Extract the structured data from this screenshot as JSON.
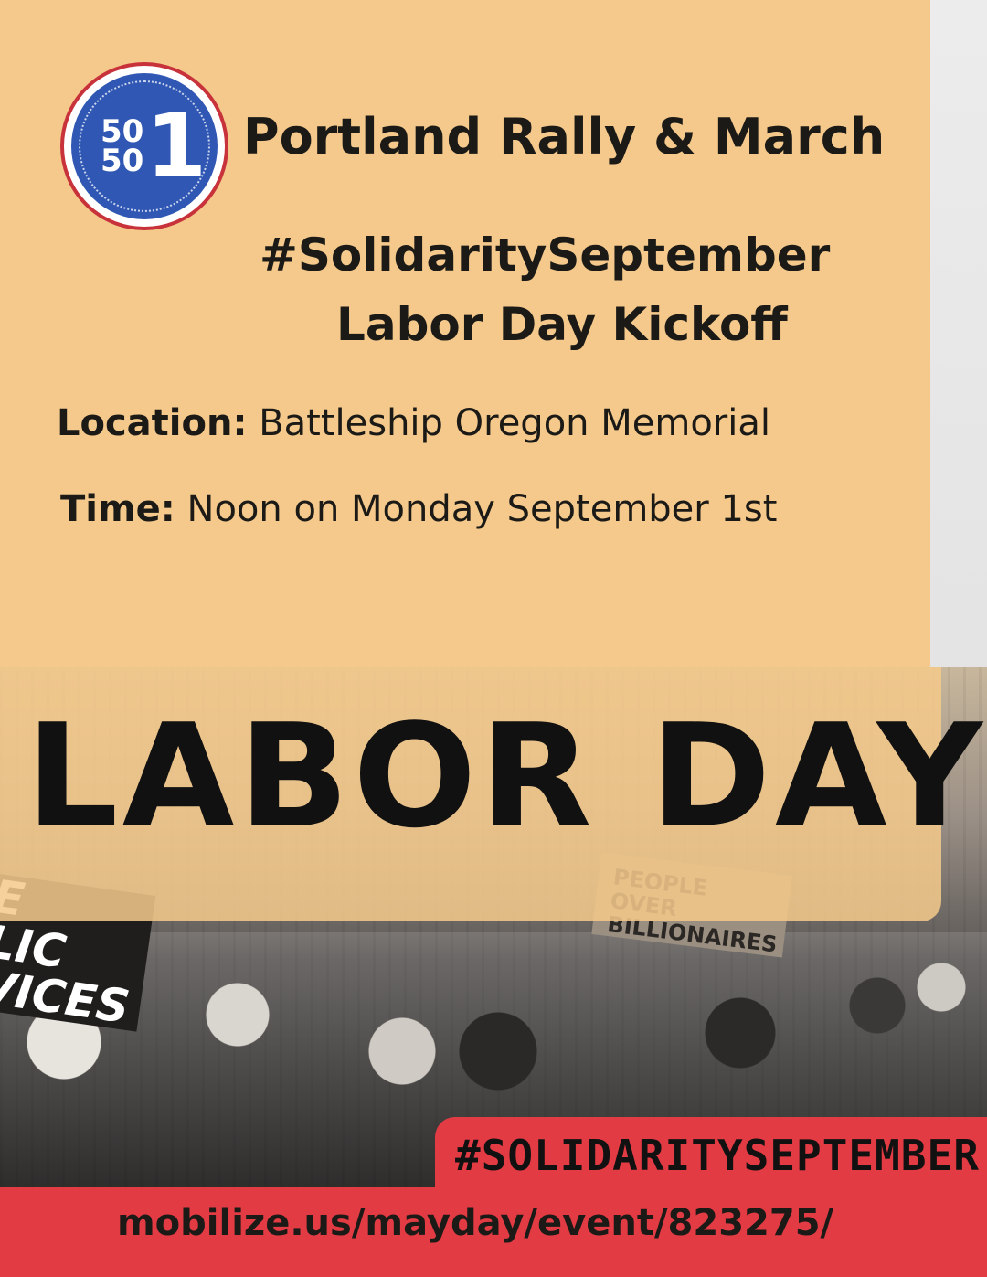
{
  "logo": {
    "top": "50",
    "bottom": "50",
    "big": "1"
  },
  "header": {
    "title": "Portland Rally & March",
    "hashtag": "#SolidaritySeptember",
    "subtitle": "Labor Day Kickoff"
  },
  "details": {
    "location_label": "Location:",
    "location_value": "Battleship Oregon Memorial",
    "time_label": "Time:",
    "time_value": "Noon on Monday September 1st"
  },
  "banner": {
    "headline": "LABOR DAY",
    "sign_left": [
      "E",
      "LIC",
      "VICES"
    ],
    "sign_people": "PEOPLE OVER BILLIONAIRES"
  },
  "pill": {
    "hashtag": "#SOLIDARITYSEPTEMBER"
  },
  "footer": {
    "url": "mobilize.us/mayday/event/823275/"
  },
  "colors": {
    "tan": "#f4c98b",
    "red": "#e23b44",
    "logo_blue": "#2f57b3",
    "logo_ring": "#c8323a",
    "text_dark": "#1c1a17"
  }
}
